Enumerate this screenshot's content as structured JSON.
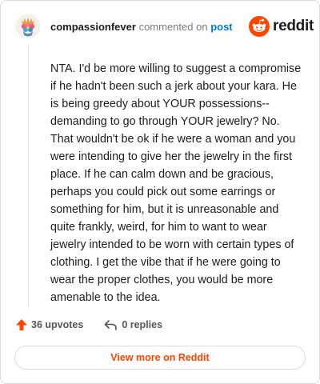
{
  "header": {
    "username": "compassionfever",
    "action": "commented on",
    "link": "post",
    "avatar_icon": "user-avatar-icon"
  },
  "brand": {
    "wordmark": "reddit",
    "logo_icon": "reddit-logo-icon",
    "color": "#ff4500"
  },
  "comment": {
    "lines": [
      "NTA. I'd be more willing to suggest a compromise",
      "if he hadn't been such a jerk about your kara. He",
      "is being greedy about YOUR possessions--",
      "demanding to go through YOUR jewelry? No.",
      "That wouldn't be ok if he were a woman and you",
      "were intending to give her the jewelry in the first",
      "place. If he can calm down and be gracious,",
      "perhaps you could pick out some earrings or",
      "something for him, but it is unreasonable and",
      "quite frankly, weird, for him to want to wear",
      "jewelry intended to be worn with certain types of",
      "clothing. I get the vibe that if he were going to",
      "wear the proper clothes, you would be more",
      "amenable to the idea."
    ]
  },
  "footer": {
    "upvotes": "36 upvotes",
    "replies": "0 replies",
    "upvote_icon": "upvote-arrow-icon",
    "reply_icon": "reply-arrow-icon",
    "upvote_color": "#ff4500"
  },
  "cta": {
    "label": "View more on Reddit"
  }
}
